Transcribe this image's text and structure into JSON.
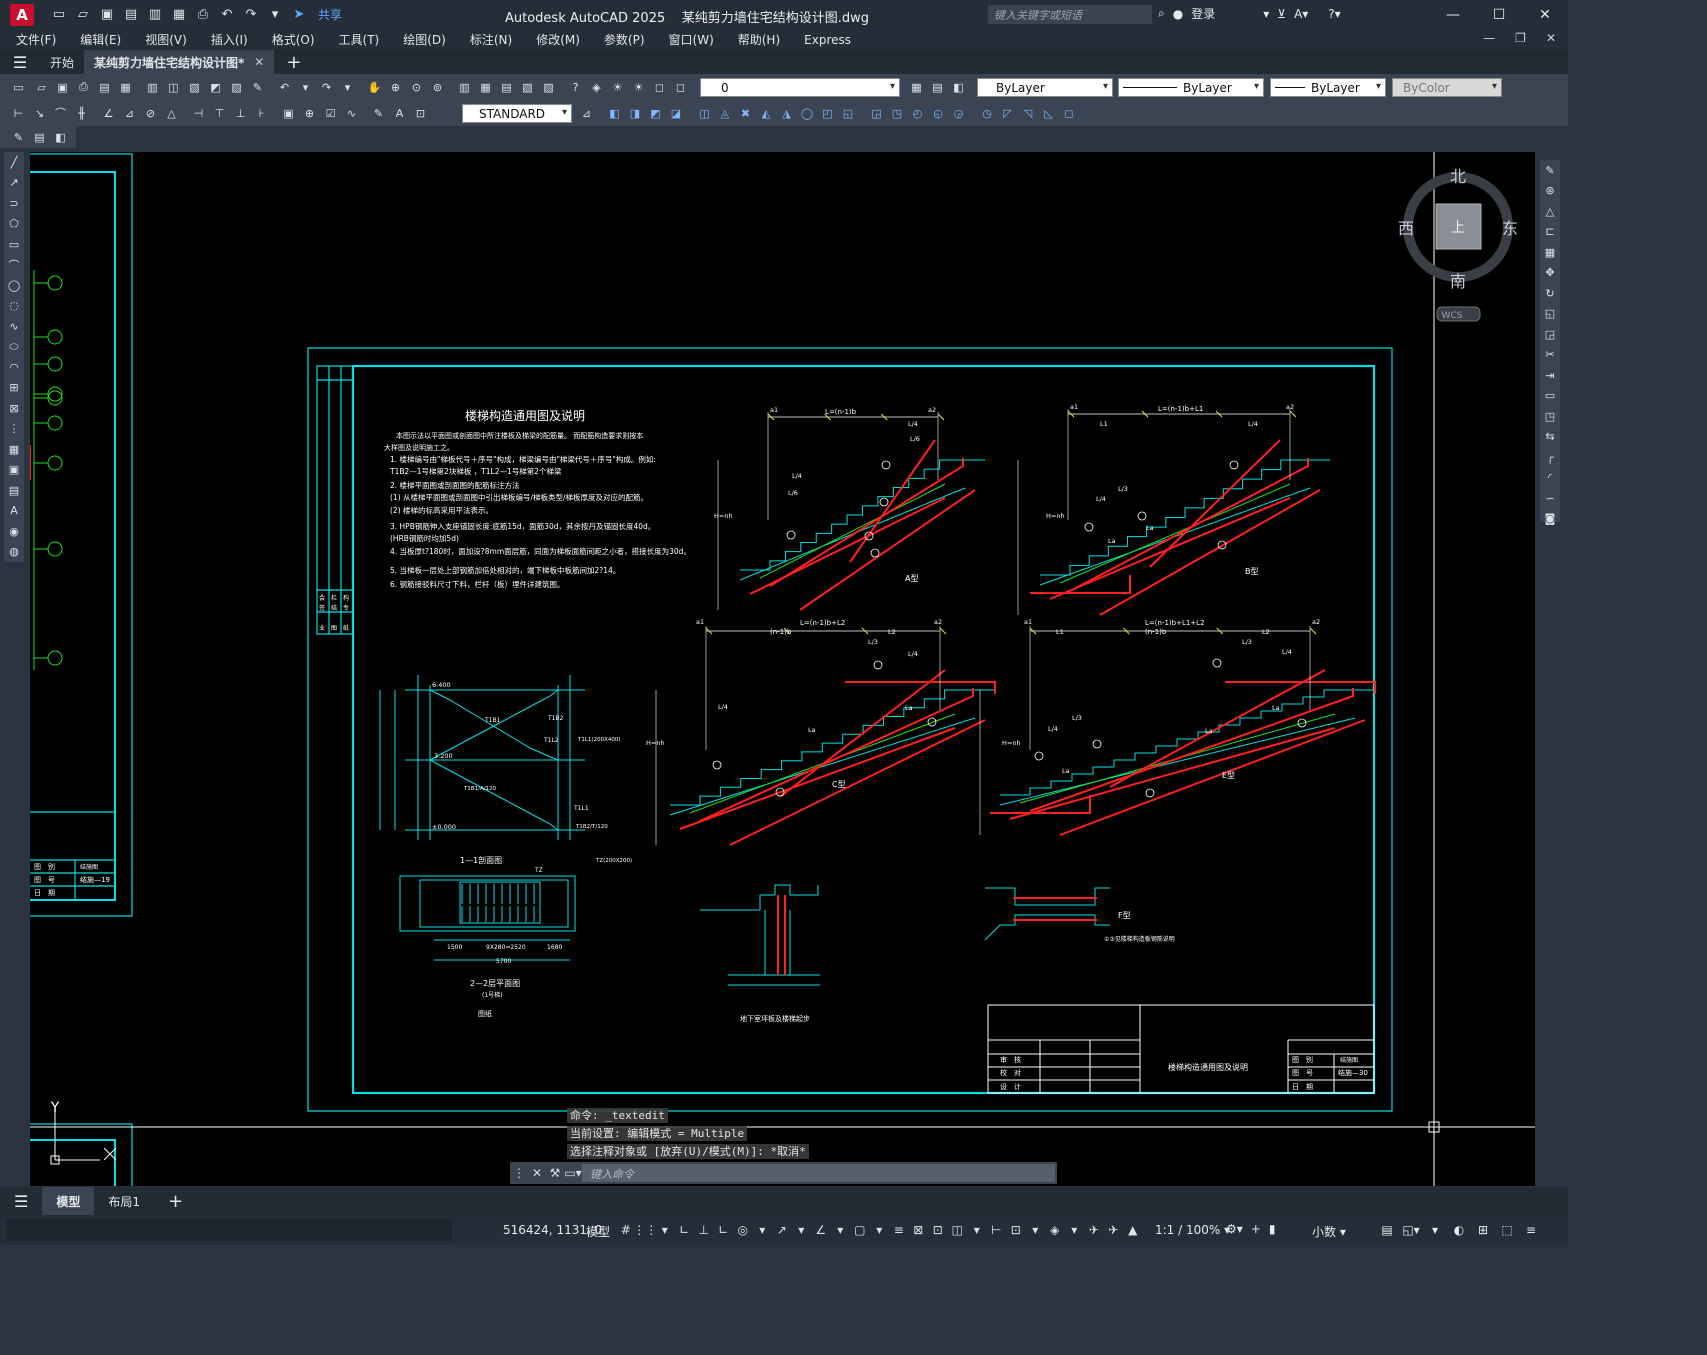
{
  "app": {
    "title": "Autodesk AutoCAD 2025",
    "filename": "某纯剪力墙住宅结构设计图.dwg",
    "logo": "A",
    "share": "共享",
    "search_placeholder": "键入关键字或短语",
    "login": "登录"
  },
  "menu": [
    "文件(F)",
    "编辑(E)",
    "视图(V)",
    "插入(I)",
    "格式(O)",
    "工具(T)",
    "绘图(D)",
    "标注(N)",
    "修改(M)",
    "参数(P)",
    "窗口(W)",
    "帮助(H)",
    "Express"
  ],
  "tabs": {
    "start": "开始",
    "drawing": "某纯剪力墙住宅结构设计图*"
  },
  "toolbar": {
    "layer": "0",
    "color": "ByLayer",
    "linetype": "ByLayer",
    "lineweight": "ByLayer",
    "plotstyle": "ByColor",
    "textstyle": "STANDARD"
  },
  "viewcube": {
    "north": "北",
    "south": "南",
    "east": "东",
    "west": "西",
    "face": "上",
    "wcs": "WCS"
  },
  "drawing": {
    "title": "楼梯构造通用图及说明",
    "intro1": "本图示法以平面图或剖面图中所注楼板及梯梁的配筋量。 而配筋构造要求则按本",
    "intro2": "大样图及说明施工之。",
    "notes": [
      "1. 楼梯编号由\"梯板代号＋序号\"构成，梯梁编号由\"梯梁代号＋序号\"构成。例如:",
      "   T1B2—1号梯第2块梯板 ，T1L2—1号梯第2个梯梁",
      "2. 楼梯平面图或剖面图的配筋标注方法",
      "  (1) 从楼梯平面图或剖面图中引出梯板编号/梯板类型/梯板厚度及对应的配筋。",
      "  (2) 楼梯的标高采用平法表示。",
      "3. HPB钢筋伸入支座锚固长度:底筋15d，面筋30d，其余按丹及锚固长度40d。",
      "  (HRB钢筋时均加5d)",
      "4. 当板厚t?180时，面加设?8mm面层筋，同面为梯板面筋间距之小者，搭接长度为30d。",
      "5. 当梯板一层处上部钢筋加倍处相对的，端下梯板中板筋间加2?14。",
      "6. 钢筋接驳料尺寸下料，栏杆（板）埋件详建筑图。"
    ],
    "type_a": "A型",
    "type_b": "B型",
    "type_c": "C型",
    "type_e": "E型",
    "type_f": "F型",
    "dim_a": "L=(n-1)b",
    "dim_b": "L=(n-1)b+L1",
    "dim_c": "L=(n-1)b+L2",
    "dim_e": "L=(n-1)b+L1+L2",
    "dim_n1b": "(n-1)b",
    "l4": "L/4",
    "l3": "L/3",
    "l6": "L/6",
    "l1": "L1",
    "l2": "L2",
    "la": "La",
    "a1": "a1",
    "a2": "a2",
    "hnh": "H=nh",
    "section_11": "1—1剖面图",
    "plan_22": "2—2层平面图",
    "plan_sub": "(1号梯)",
    "ref_note": "图纸",
    "basement": "地下室坪板及楼梯起步",
    "f_note": "①③见楼梯构造板钢筋说明",
    "elev_1": "6.400",
    "elev_2": "3.200",
    "elev_3": "±0.000",
    "h_1600a": "10X160 =1600",
    "h_3200": "3200",
    "t1b1": "T1B1",
    "t1b2": "T1B2",
    "t1l2": "T1L2",
    "t1l1": "T1L1",
    "t1l1_spec": "T1L1(200X400)",
    "t1b1_spec": "T1B1/A/120",
    "t1b2_spec": "T1B2/T/120",
    "dim_1500": "1500",
    "dim_steps": "9X280=2520",
    "dim_1680": "1680",
    "dim_5700": "5700",
    "tz": "TZ",
    "tz_spec": "TZ(200X200)",
    "tb_review": "审　核",
    "tb_check": "校　对",
    "tb_design": "设　计",
    "tb_cat": "图　别",
    "tb_no": "图　号",
    "tb_date": "日　期",
    "tb_cat_val": "结施图",
    "tb_no_val": "结施—30",
    "tb_no_val_left": "结施—19",
    "side_labels": [
      "会",
      "签",
      "栏",
      "结",
      "构",
      "专",
      "业",
      "图",
      "纸"
    ]
  },
  "command": {
    "line1": "命令: _textedit",
    "line2": "当前设置: 编辑模式 = Multiple",
    "line3": "选择注释对象或 [放弃(U)/模式(M)]: *取消*",
    "placeholder": "键入命令"
  },
  "layout_tabs": {
    "model": "模型",
    "layout1": "布局1"
  },
  "status": {
    "coords": "516424, 1131, 0",
    "model": "模型",
    "scale": "1:1 / 100%",
    "units": "小数"
  },
  "colors": {
    "cyan": "#00e0e0",
    "red": "#ff2020",
    "green": "#20e020",
    "yellow": "#e8e820",
    "white": "#ffffff"
  }
}
